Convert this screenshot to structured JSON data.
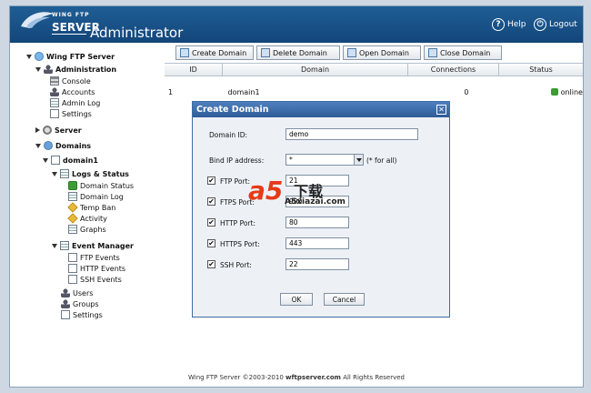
{
  "app": {
    "logo_top": "WING FTP",
    "logo_main": "SERVER",
    "title": "Administrator",
    "help_label": "Help",
    "logout_label": "Logout"
  },
  "sidebar": {
    "root": "Wing FTP Server",
    "administration": "Administration",
    "admin_items": [
      "Console",
      "Accounts",
      "Admin Log",
      "Settings"
    ],
    "server": "Server",
    "domains": "Domains",
    "domain1": "domain1",
    "logs_status": "Logs & Status",
    "logs_items": [
      "Domain Status",
      "Domain Log",
      "Temp Ban",
      "Activity",
      "Graphs"
    ],
    "event_manager": "Event Manager",
    "event_items": [
      "FTP Events",
      "HTTP Events",
      "SSH Events"
    ],
    "domain_items": [
      "Users",
      "Groups",
      "Settings"
    ]
  },
  "toolbar": {
    "create": "Create Domain",
    "delete": "Delete Domain",
    "open": "Open Domain",
    "close": "Close Domain"
  },
  "table": {
    "columns": [
      "ID",
      "Domain",
      "Connections",
      "Status"
    ],
    "rows": [
      {
        "id": "1",
        "domain": "domain1",
        "connections": "0",
        "status": "online"
      }
    ]
  },
  "dialog": {
    "title": "Create Domain",
    "close_glyph": "✕",
    "domain_id_label": "Domain ID:",
    "domain_id_value": "demo",
    "bind_ip_label": "Bind IP address:",
    "bind_ip_value": "*",
    "bind_ip_hint": "(* for all)",
    "ports": [
      {
        "label": "FTP Port:",
        "value": "21"
      },
      {
        "label": "FTPS Port:",
        "value": "990"
      },
      {
        "label": "HTTP Port:",
        "value": "80"
      },
      {
        "label": "HTTPS Port:",
        "value": "443"
      },
      {
        "label": "SSH Port:",
        "value": "22"
      }
    ],
    "ok_label": "OK",
    "cancel_label": "Cancel"
  },
  "footer": {
    "prefix": "Wing FTP Server ©2003-2010",
    "site": "wftpserver.com",
    "suffix": "All Rights Reserved"
  },
  "watermark": {
    "logo": "a5",
    "chinese": "下载",
    "url": "A5xiazai.com"
  },
  "colors": {
    "header_bg": "#1a5289",
    "dialog_title": "#2d5c98",
    "online": "#3c9b35"
  }
}
